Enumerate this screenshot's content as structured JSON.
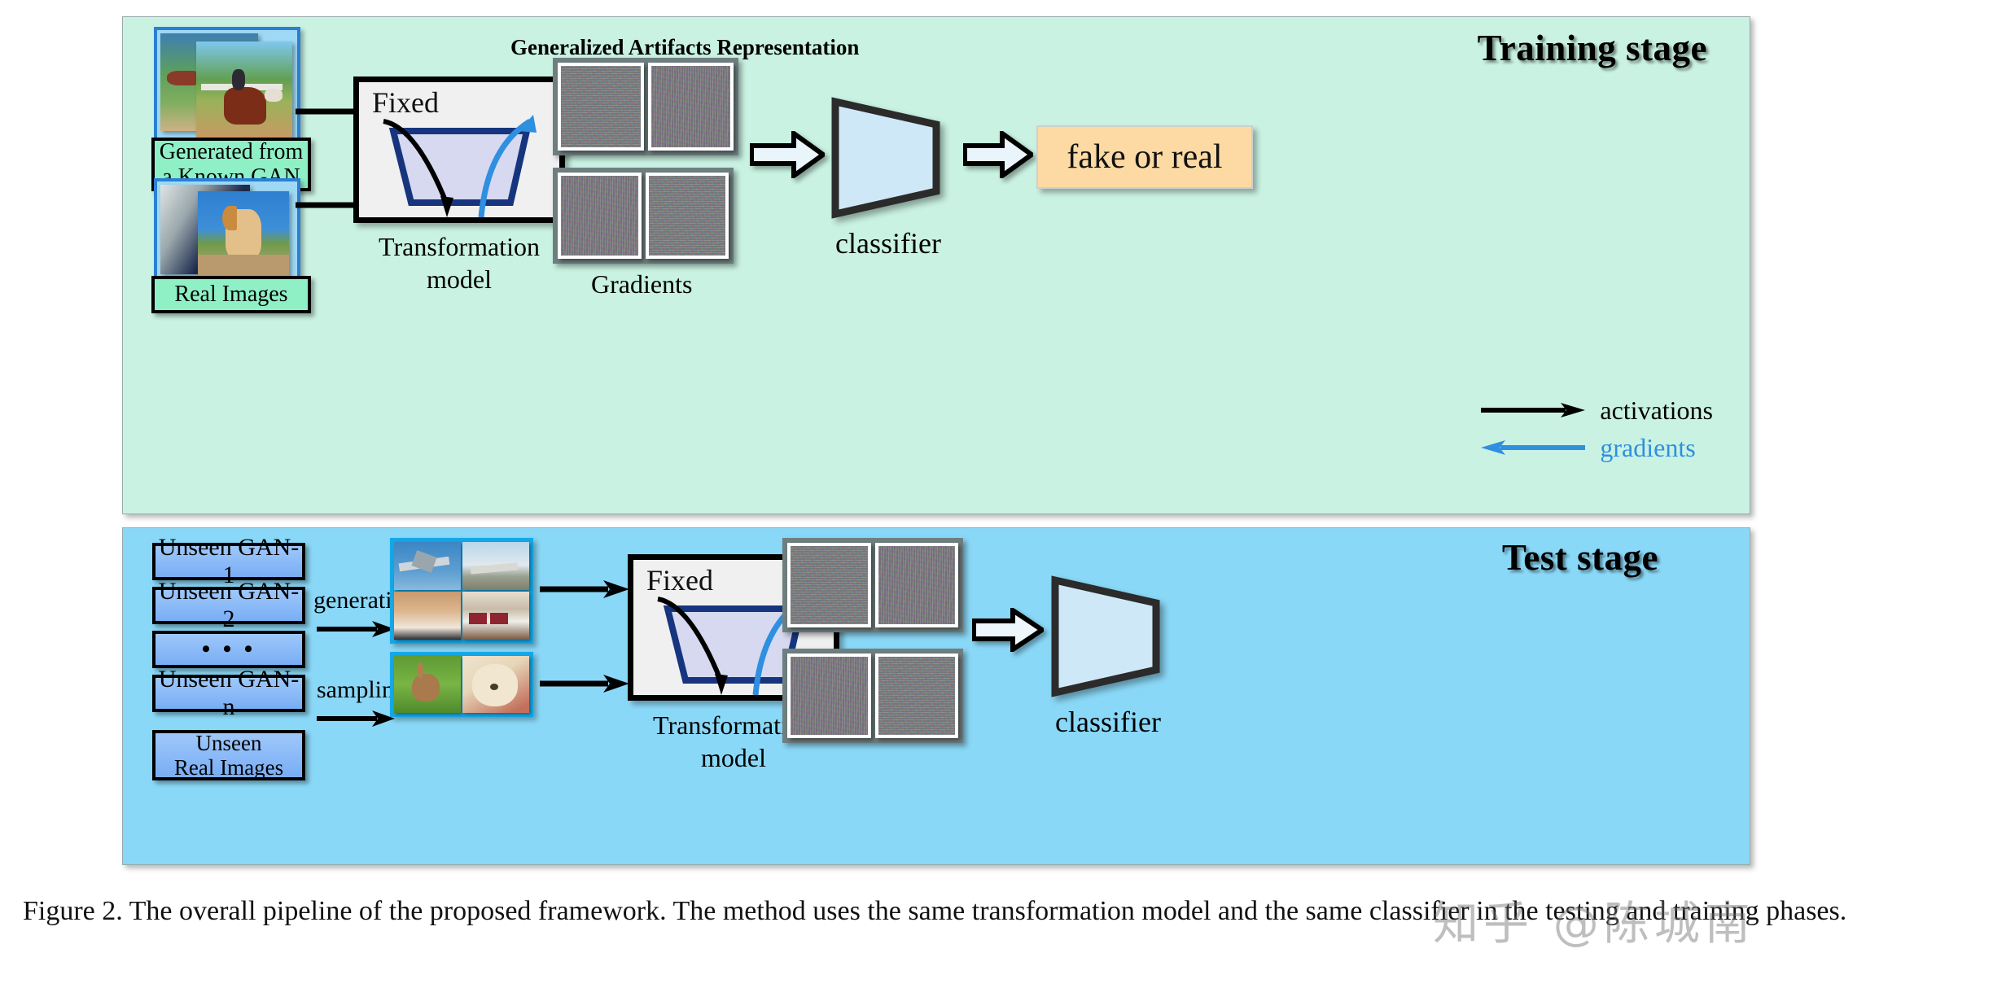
{
  "figure": {
    "caption": "Figure 2. The overall pipeline of the proposed framework. The method uses the same transformation model and the same classifier in the testing and training phases.",
    "watermark": "知乎 @陈城南"
  },
  "training": {
    "title": "Training stage",
    "inputs": [
      {
        "label": "Generated from\na Known GAN",
        "label_line1": "Generated from",
        "label_line2": "a Known GAN"
      },
      {
        "label": "Real Images"
      }
    ],
    "transformation": {
      "fixed_label": "Fixed",
      "caption_line1": "Transformation",
      "caption_line2": "model"
    },
    "representation_title": "Generalized Artifacts Representation",
    "gradients_caption": "Gradients",
    "classifier_label": "classifier",
    "output_label": "fake or real",
    "legend": [
      {
        "name": "activations",
        "color": "#000000",
        "direction": "right"
      },
      {
        "name": "gradients",
        "color": "#2f8fe0",
        "direction": "left"
      }
    ]
  },
  "test": {
    "title": "Test stage",
    "sources": [
      {
        "label": "Unseen GAN-1"
      },
      {
        "label": "Unseen GAN-2"
      },
      {
        "label": "• • •"
      },
      {
        "label": "Unseen GAN-n"
      },
      {
        "label_line1": "Unseen",
        "label_line2": "Real Images"
      }
    ],
    "verbs": {
      "generating": "generating",
      "sampling": "sampling"
    },
    "transformation": {
      "fixed_label": "Fixed",
      "caption_line1": "Transformation",
      "caption_line2": "model"
    },
    "classifier_label": "classifier"
  },
  "colors": {
    "training_bg": "#c9f2e2",
    "test_bg": "#8ad8f7",
    "accent_blue": "#2b7fd4",
    "gradient_blue": "#2f8fe0",
    "output_box": "#fdd9a4",
    "classifier_fill": "#d6ecfa",
    "funnel_stroke": "#17357f"
  }
}
